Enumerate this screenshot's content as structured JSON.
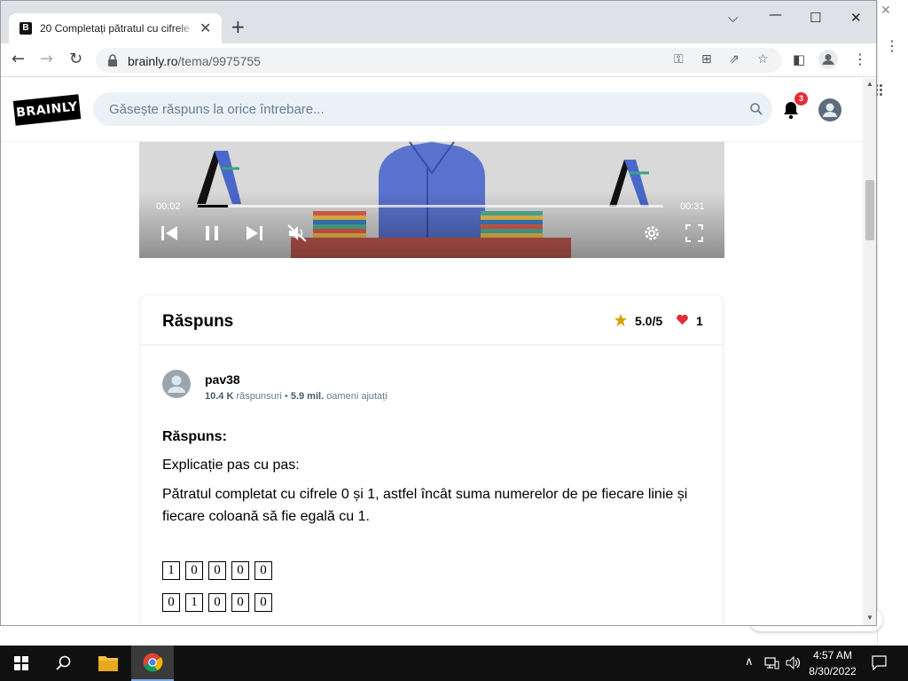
{
  "browser": {
    "tab_title": "20 Completați pătratul cu cifrele",
    "tab_favicon": "B",
    "url_host": "brainly.ro",
    "url_path": "/tema/9975755"
  },
  "site": {
    "logo_text": "BRAINLY",
    "search_placeholder": "Găsește răspuns la orice întrebare...",
    "notification_count": "3"
  },
  "video": {
    "current_time": "00:02",
    "total_time": "00:31",
    "progress": 0.065
  },
  "answer": {
    "title": "Răspuns",
    "rating": "5.0/5",
    "thanks": "1",
    "author": {
      "name": "pav38",
      "answers_count": "10.4 K",
      "answers_label": "răspunsuri",
      "helped_count": "5.9 mil.",
      "helped_label": "oameni ajutați"
    },
    "label": "Răspuns:",
    "explanation_label": "Explicație pas cu pas:",
    "text": "Pătratul completat cu cifrele 0 și 1, astfel încât suma numerelor de pe fiecare linie și fiecare coloană să fie egală cu 1.",
    "grid_rows": [
      [
        "1",
        "0",
        "0",
        "0",
        "0"
      ],
      [
        "0",
        "1",
        "0",
        "0",
        "0"
      ]
    ]
  },
  "taskbar": {
    "time": "4:57 AM",
    "date": "8/30/2022"
  },
  "colors": {
    "brand_black": "#000000",
    "badge_red": "#e22d37",
    "star_gold": "#d7a200",
    "heart_red": "#e22d37",
    "search_bg": "#ebf2f7"
  }
}
